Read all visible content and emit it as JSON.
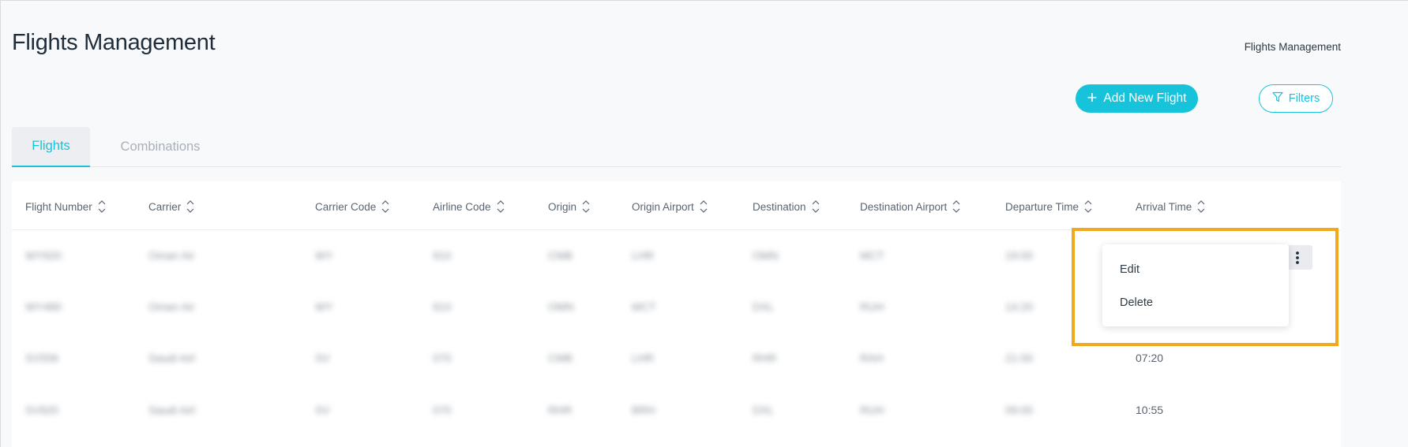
{
  "header": {
    "title": "Flights Management",
    "breadcrumb": "Flights Management"
  },
  "actions": {
    "add_label": "Add New Flight",
    "filters_label": "Filters"
  },
  "tabs": [
    {
      "label": "Flights",
      "active": true
    },
    {
      "label": "Combinations",
      "active": false
    }
  ],
  "table": {
    "columns": [
      "Flight Number",
      "Carrier",
      "Carrier Code",
      "Airline Code",
      "Origin",
      "Origin Airport",
      "Destination",
      "Destination Airport",
      "Departure Time",
      "Arrival Time"
    ],
    "rows": [
      {
        "cells": [
          "WY920",
          "Oman Air",
          "WY",
          "910",
          "CMB",
          "LHR",
          "OMN",
          "MCT",
          "19:00",
          ""
        ]
      },
      {
        "cells": [
          "WY480",
          "Oman Air",
          "WY",
          "910",
          "OMN",
          "MCT",
          "DXL",
          "RUH",
          "14:20",
          ""
        ]
      },
      {
        "cells": [
          "SV556",
          "Saudi Airl",
          "SV",
          "070",
          "CMB",
          "LHR",
          "RHR",
          "RAH",
          "21:00",
          "07:20"
        ]
      },
      {
        "cells": [
          "SV920",
          "Saudi Airl",
          "SV",
          "070",
          "RHR",
          "BRH",
          "DXL",
          "RUH",
          "09:00",
          "10:55"
        ]
      }
    ]
  },
  "row_menu": {
    "items": [
      "Edit",
      "Delete"
    ]
  },
  "colors": {
    "accent": "#17c3db",
    "highlight": "#f2a81d"
  }
}
